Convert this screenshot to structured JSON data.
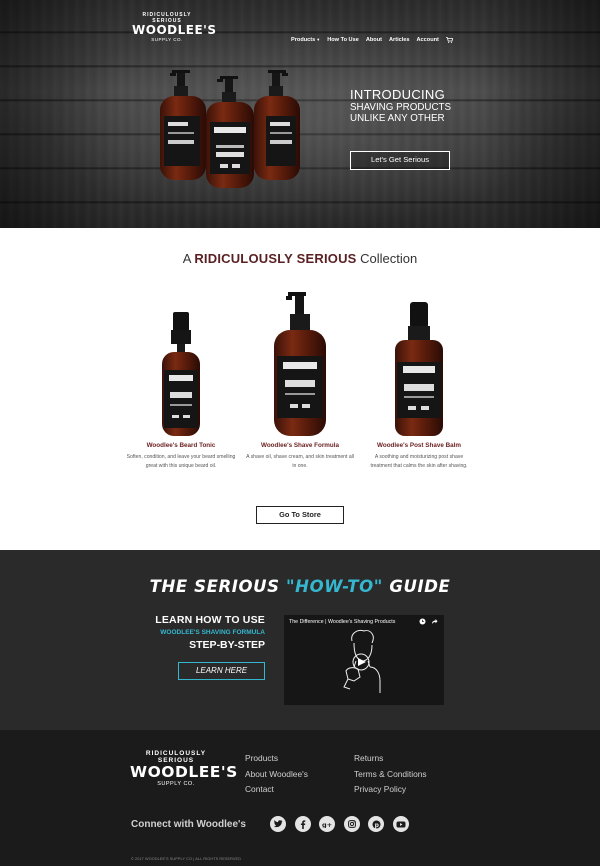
{
  "header": {
    "logo": {
      "arc": "RIDICULOUSLY SERIOUS",
      "name": "WOODLEE'S",
      "sub": "SUPPLY CO."
    },
    "nav": [
      {
        "label": "Products",
        "has_dropdown": true
      },
      {
        "label": "How To Use"
      },
      {
        "label": "About"
      },
      {
        "label": "Articles"
      },
      {
        "label": "Account"
      }
    ],
    "cart_icon": "cart-icon"
  },
  "hero": {
    "line1": "INTRODUCING",
    "line2": "SHAVING PRODUCTS",
    "line3": "UNLIKE ANY OTHER",
    "cta": "Let's Get Serious"
  },
  "collection": {
    "title_prefix": "A ",
    "title_bold": "RIDICULOUSLY SERIOUS",
    "title_suffix": " Collection",
    "products": [
      {
        "name": "Woodlee's Beard Tonic",
        "desc": "Soften, condition, and leave your beard smelling great with this unique beard oil."
      },
      {
        "name": "Woodlee's Shave Formula",
        "desc": "A shave oil, shave cream, and skin treatment all in one."
      },
      {
        "name": "Woodlee's Post Shave Balm",
        "desc": "A soothing and moisturizing post shave treatment that calms the skin after shaving."
      }
    ],
    "store_button": "Go To Store"
  },
  "howto": {
    "title_prefix": "THE SERIOUS ",
    "title_accent": "\"HOW-TO\"",
    "title_suffix": " GUIDE",
    "learn_line1": "LEARN HOW TO USE",
    "learn_line2": "WOODLEE'S SHAVING FORMULA",
    "learn_line3": "STEP-BY-STEP",
    "learn_button": "LEARN HERE",
    "video_title": "The Difference | Woodlee's Shaving Products"
  },
  "footer": {
    "logo": {
      "arc": "RIDICULOUSLY SERIOUS",
      "name": "WOODLEE'S",
      "sub": "SUPPLY CO."
    },
    "col1": [
      "Products",
      "About Woodlee's",
      "Contact"
    ],
    "col2": [
      "Returns",
      "Terms & Conditions",
      "Privacy Policy"
    ],
    "connect": "Connect with Woodlee's",
    "socials": [
      "twitter-icon",
      "facebook-icon",
      "google-plus-icon",
      "instagram-icon",
      "pinterest-icon",
      "youtube-icon"
    ],
    "copyright": "© 2017 WOODLEE'S SUPPLY CO | ALL RIGHTS RESERVED"
  },
  "colors": {
    "accent": "#35b8cf",
    "brand": "#5a1f22",
    "product_name": "#6a1f1f",
    "dark": "#2a2a2b",
    "footer": "#1b1b1b"
  }
}
